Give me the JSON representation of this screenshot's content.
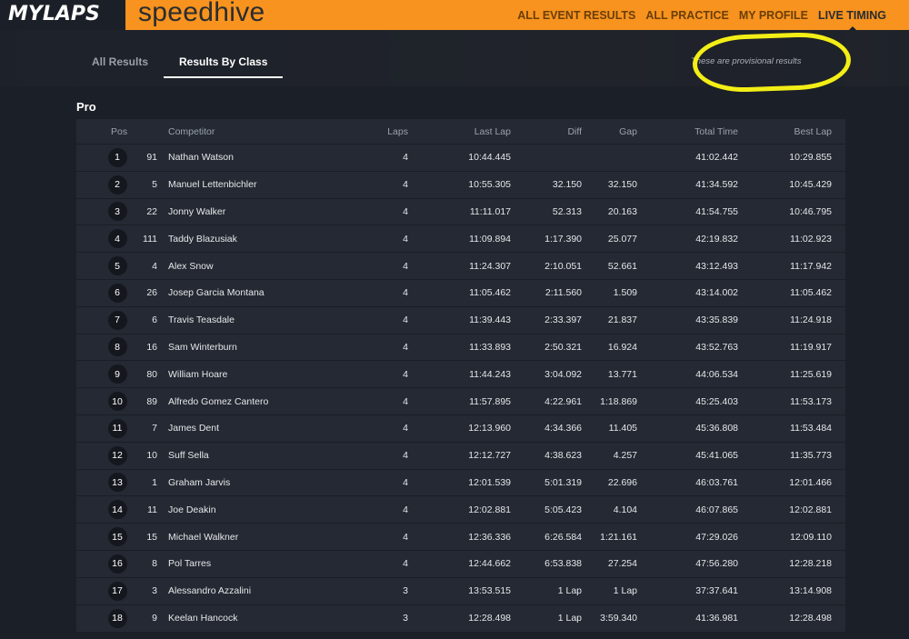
{
  "brand": {
    "mylaps": "MYLAPS",
    "speedhive": "speedhive"
  },
  "topnav": [
    {
      "label": "ALL EVENT RESULTS",
      "active": false
    },
    {
      "label": "ALL PRACTICE",
      "active": false
    },
    {
      "label": "MY PROFILE",
      "active": false
    },
    {
      "label": "LIVE TIMING",
      "active": true
    }
  ],
  "tabs": [
    {
      "label": "All Results",
      "active": false
    },
    {
      "label": "Results By Class",
      "active": true
    }
  ],
  "provisional_note": "These are provisional results",
  "colors": {
    "accent": "#f7931e",
    "background": "#1b1f27",
    "table": "#242933",
    "highlight": "#f3ee16"
  },
  "class_name": "Pro",
  "columns": {
    "pos": "Pos",
    "competitor": "Competitor",
    "laps": "Laps",
    "last_lap": "Last Lap",
    "diff": "Diff",
    "gap": "Gap",
    "total_time": "Total Time",
    "best_lap": "Best Lap"
  },
  "rows": [
    {
      "pos": "1",
      "num": "91",
      "name": "Nathan Watson",
      "laps": "4",
      "last": "10:44.445",
      "diff": "",
      "gap": "",
      "total": "41:02.442",
      "best": "10:29.855"
    },
    {
      "pos": "2",
      "num": "5",
      "name": "Manuel Lettenbichler",
      "laps": "4",
      "last": "10:55.305",
      "diff": "32.150",
      "gap": "32.150",
      "total": "41:34.592",
      "best": "10:45.429"
    },
    {
      "pos": "3",
      "num": "22",
      "name": "Jonny Walker",
      "laps": "4",
      "last": "11:11.017",
      "diff": "52.313",
      "gap": "20.163",
      "total": "41:54.755",
      "best": "10:46.795"
    },
    {
      "pos": "4",
      "num": "111",
      "name": "Taddy Blazusiak",
      "laps": "4",
      "last": "11:09.894",
      "diff": "1:17.390",
      "gap": "25.077",
      "total": "42:19.832",
      "best": "11:02.923"
    },
    {
      "pos": "5",
      "num": "4",
      "name": "Alex Snow",
      "laps": "4",
      "last": "11:24.307",
      "diff": "2:10.051",
      "gap": "52.661",
      "total": "43:12.493",
      "best": "11:17.942"
    },
    {
      "pos": "6",
      "num": "26",
      "name": "Josep Garcia Montana",
      "laps": "4",
      "last": "11:05.462",
      "diff": "2:11.560",
      "gap": "1.509",
      "total": "43:14.002",
      "best": "11:05.462"
    },
    {
      "pos": "7",
      "num": "6",
      "name": "Travis Teasdale",
      "laps": "4",
      "last": "11:39.443",
      "diff": "2:33.397",
      "gap": "21.837",
      "total": "43:35.839",
      "best": "11:24.918"
    },
    {
      "pos": "8",
      "num": "16",
      "name": "Sam Winterburn",
      "laps": "4",
      "last": "11:33.893",
      "diff": "2:50.321",
      "gap": "16.924",
      "total": "43:52.763",
      "best": "11:19.917"
    },
    {
      "pos": "9",
      "num": "80",
      "name": "William Hoare",
      "laps": "4",
      "last": "11:44.243",
      "diff": "3:04.092",
      "gap": "13.771",
      "total": "44:06.534",
      "best": "11:25.619"
    },
    {
      "pos": "10",
      "num": "89",
      "name": "Alfredo Gomez Cantero",
      "laps": "4",
      "last": "11:57.895",
      "diff": "4:22.961",
      "gap": "1:18.869",
      "total": "45:25.403",
      "best": "11:53.173"
    },
    {
      "pos": "11",
      "num": "7",
      "name": "James Dent",
      "laps": "4",
      "last": "12:13.960",
      "diff": "4:34.366",
      "gap": "11.405",
      "total": "45:36.808",
      "best": "11:53.484"
    },
    {
      "pos": "12",
      "num": "10",
      "name": "Suff Sella",
      "laps": "4",
      "last": "12:12.727",
      "diff": "4:38.623",
      "gap": "4.257",
      "total": "45:41.065",
      "best": "11:35.773"
    },
    {
      "pos": "13",
      "num": "1",
      "name": "Graham Jarvis",
      "laps": "4",
      "last": "12:01.539",
      "diff": "5:01.319",
      "gap": "22.696",
      "total": "46:03.761",
      "best": "12:01.466"
    },
    {
      "pos": "14",
      "num": "11",
      "name": "Joe Deakin",
      "laps": "4",
      "last": "12:02.881",
      "diff": "5:05.423",
      "gap": "4.104",
      "total": "46:07.865",
      "best": "12:02.881"
    },
    {
      "pos": "15",
      "num": "15",
      "name": "Michael Walkner",
      "laps": "4",
      "last": "12:36.336",
      "diff": "6:26.584",
      "gap": "1:21.161",
      "total": "47:29.026",
      "best": "12:09.110"
    },
    {
      "pos": "16",
      "num": "8",
      "name": "Pol Tarres",
      "laps": "4",
      "last": "12:44.662",
      "diff": "6:53.838",
      "gap": "27.254",
      "total": "47:56.280",
      "best": "12:28.218"
    },
    {
      "pos": "17",
      "num": "3",
      "name": "Alessandro Azzalini",
      "laps": "3",
      "last": "13:53.515",
      "diff": "1 Lap",
      "gap": "1 Lap",
      "total": "37:37.641",
      "best": "13:14.908"
    },
    {
      "pos": "18",
      "num": "9",
      "name": "Keelan Hancock",
      "laps": "3",
      "last": "12:28.498",
      "diff": "1 Lap",
      "gap": "3:59.340",
      "total": "41:36.981",
      "best": "12:28.498"
    }
  ]
}
